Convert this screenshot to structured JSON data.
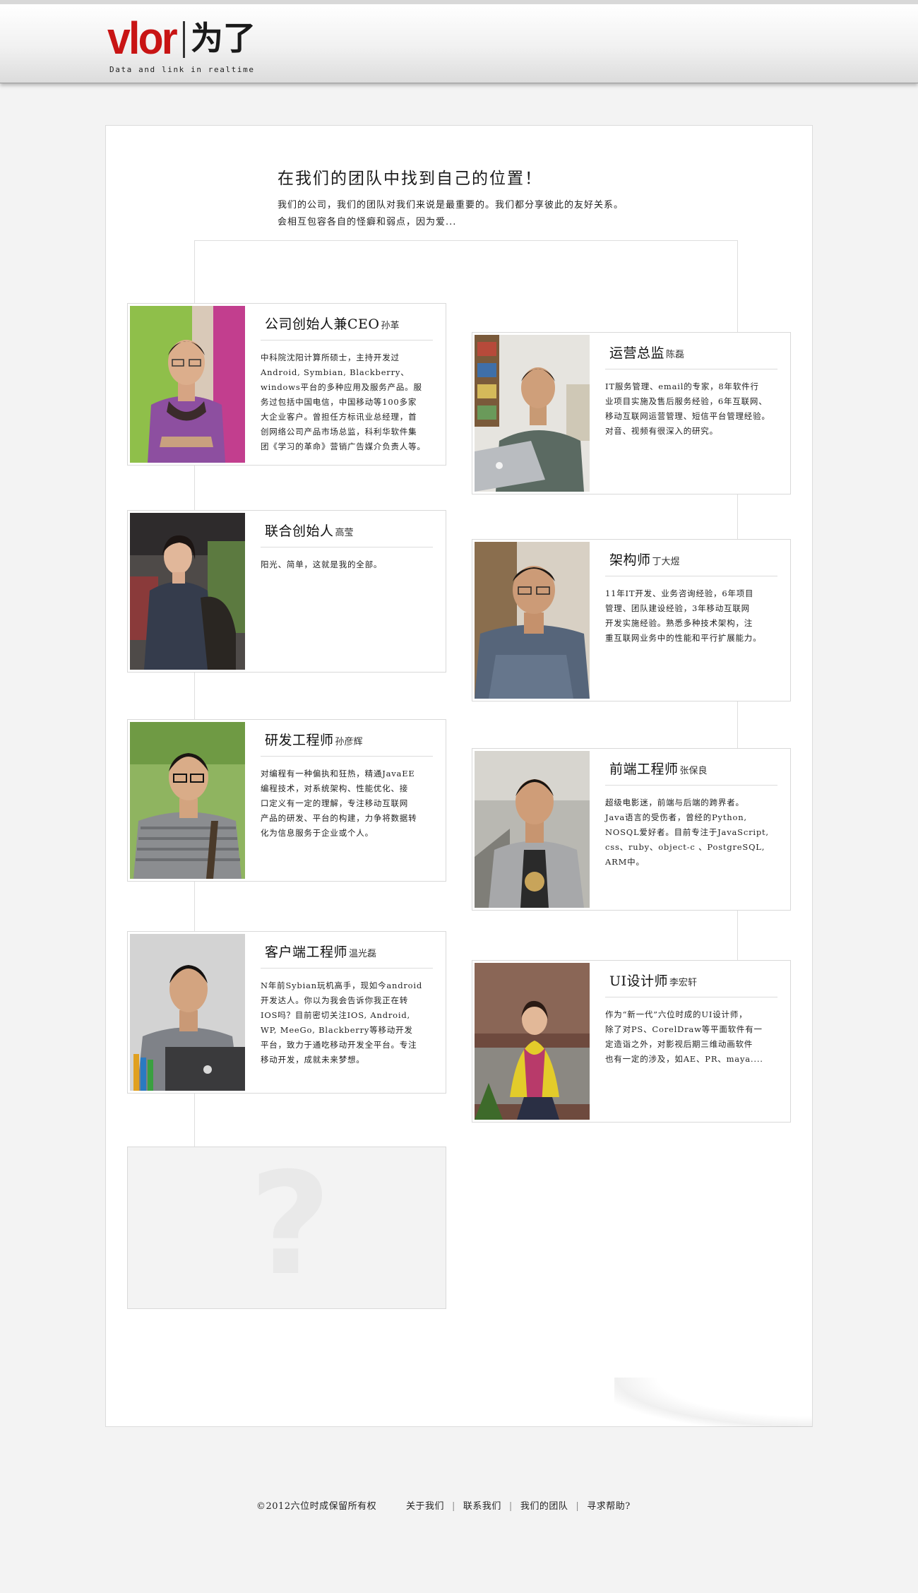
{
  "header": {
    "logo_latin": "vlor",
    "logo_cn": "为了",
    "tagline": "Data and link in realtime"
  },
  "intro": {
    "title": "在我们的团队中找到自己的位置！",
    "line1": "我们的公司，我们的团队对我们来说是最重要的。我们都分享彼此的友好关系。",
    "line2": "会相互包容各自的怪癖和弱点，因为爱..."
  },
  "team": [
    {
      "role": "公司创始人兼CEO",
      "name": "孙革",
      "desc": "中科院沈阳计算所硕士，主持开发过\nAndroid, Symbian, Blackberry、\nwindows平台的多种应用及服务产品。服\n务过包括中国电信，中国移动等100多家\n大企业客户。曾担任方标讯业总经理，首\n创网络公司产品市场总监，科利华软件集\n团《学习的革命》营销广告媒介负责人等。"
    },
    {
      "role": "运营总监",
      "name": "陈磊",
      "desc": "IT服务管理、email的专家，8年软件行\n业项目实施及售后服务经验，6年互联网、\n移动互联网运营管理、短信平台管理经验。\n对音、视频有很深入的研究。"
    },
    {
      "role": "联合创始人",
      "name": "高莹",
      "desc": "阳光、简单，这就是我的全部。"
    },
    {
      "role": "架构师",
      "name": "丁大煜",
      "desc": "11年IT开发、业务咨询经验，6年项目\n管理、团队建设经验，3年移动互联网\n开发实施经验。熟悉多种技术架构，注\n重互联网业务中的性能和平行扩展能力。"
    },
    {
      "role": "研发工程师",
      "name": "孙彦辉",
      "desc": "对编程有一种偏执和狂热，精通JavaEE\n编程技术，对系统架构、性能优化、接\n口定义有一定的理解，专注移动互联网\n产品的研发、平台的构建，力争将数据转\n化为信息服务于企业或个人。"
    },
    {
      "role": "前端工程师",
      "name": "张保良",
      "desc": "超级电影迷，前端与后端的跨界者。\nJava语言的受伤者，曾经的Python,\nNOSQL爱好者。目前专注于JavaScript,\ncss、ruby、object-c 、PostgreSQL,\nARM中。"
    },
    {
      "role": "客户端工程师",
      "name": "温光磊",
      "desc": "N年前Sybian玩机高手，现如今android\n开发达人。你以为我会告诉你我正在转\nIOS吗？目前密切关注IOS, Android,\n WP, MeeGo, Blackberry等移动开发\n平台，致力于通吃移动开发全平台。专注\n移动开发，成就未来梦想。"
    },
    {
      "role": "UI设计师",
      "name": "李宏轩",
      "desc": "作为“新一代”六位时成的UI设计师，\n除了对PS、CorelDraw等平面软件有一\n定造诣之外，对影视后期三维动画软件\n也有一定的涉及，如AE、PR、maya...."
    }
  ],
  "mystery": {
    "symbol": "?"
  },
  "footer": {
    "copyright": "©2012六位时成保留所有权",
    "links": [
      "关于我们",
      "联系我们",
      "我们的团队",
      "寻求帮助?"
    ]
  }
}
